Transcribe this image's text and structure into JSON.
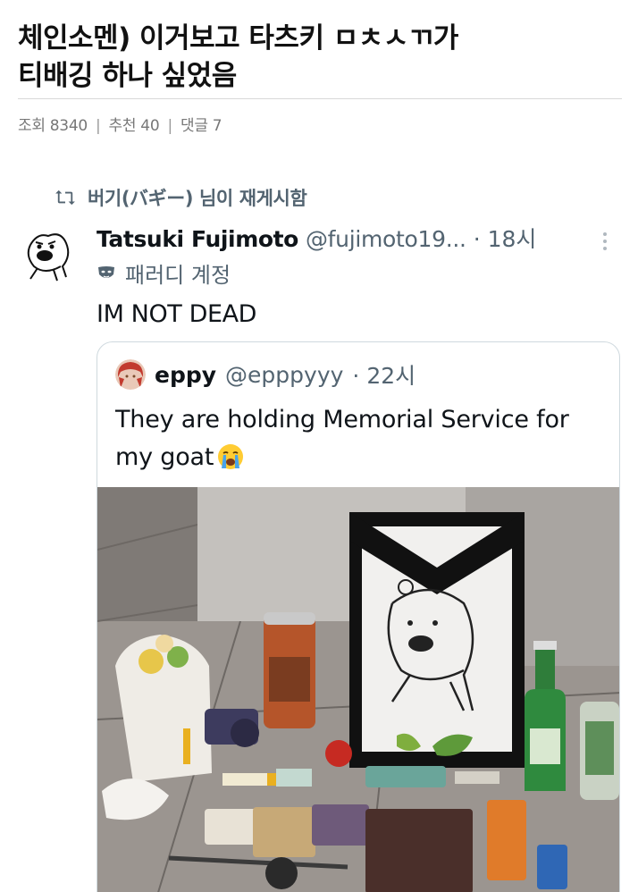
{
  "post": {
    "title_line1": "체인소멘) 이거보고 타츠키 ㅁㅊㅅㄲ가",
    "title_line2": "티배깅 하나 싶었음",
    "meta": {
      "views_label": "조회 8340",
      "recommend_label": "추천 40",
      "comments_label": "댓글 7",
      "separator": "|"
    }
  },
  "tweet": {
    "retweet_text": "버기(バギー) 님이 재게시함",
    "display_name": "Tatsuki Fujimoto",
    "handle": "@fujimoto19...",
    "time": "· 18시",
    "parody_label": "패러디 계정",
    "text": "IM NOT DEAD",
    "icons": [
      "retweet-icon",
      "more-icon",
      "parody-mask-icon"
    ]
  },
  "quote": {
    "display_name": "eppy",
    "handle": "@epppyyy",
    "time": "· 22시",
    "text": "They are holding Memorial Service for my goat",
    "emoji": "crying-face-emoji"
  },
  "colors": {
    "text_primary": "#0f1419",
    "text_secondary": "#536471",
    "border": "#cfd9de",
    "meta_gray": "#777777"
  }
}
